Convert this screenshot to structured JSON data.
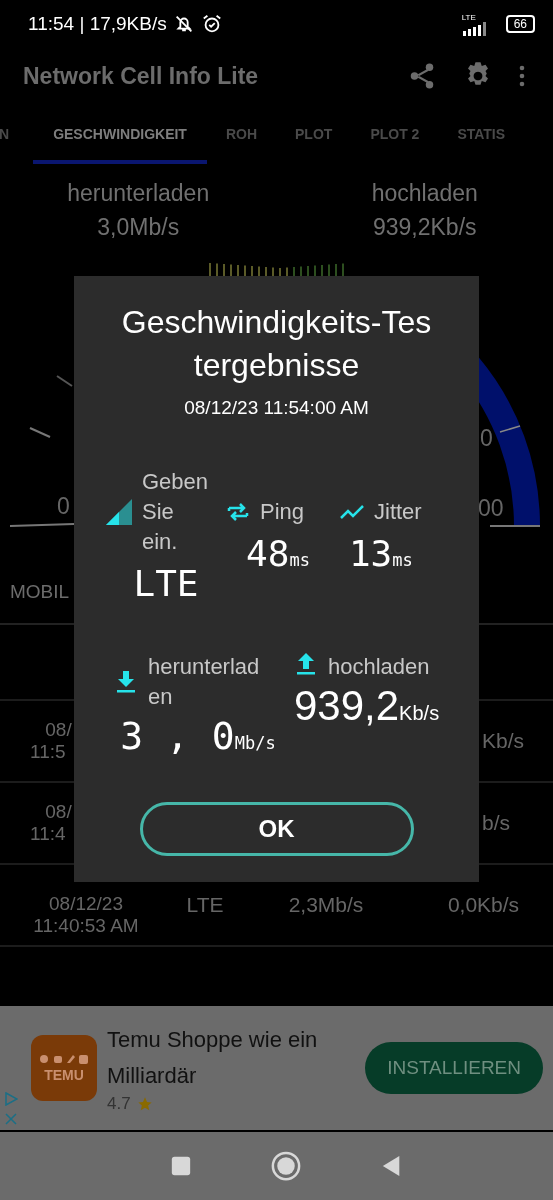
{
  "status_bar": {
    "time": "11:54 | 17,9KB/s",
    "network": "LTE",
    "battery": "66"
  },
  "app_bar": {
    "title": "Network Cell Info Lite"
  },
  "tabs": [
    {
      "label": "N",
      "selected": false
    },
    {
      "label": "GESCHWINDIGKEIT",
      "selected": true
    },
    {
      "label": "ROH",
      "selected": false
    },
    {
      "label": "PLOT",
      "selected": false
    },
    {
      "label": "PLOT 2",
      "selected": false
    },
    {
      "label": "STATIS",
      "selected": false
    }
  ],
  "summary": [
    {
      "label": "herunterladen",
      "value": "3,0Mb/s"
    },
    {
      "label": "hochladen",
      "value": "939,2Kb/s"
    }
  ],
  "gauge": {
    "scale_labels": [
      "0",
      "0",
      "00"
    ]
  },
  "section_label": "MOBIL",
  "table": {
    "rows": [
      {
        "date": "08/",
        "time": "11:5",
        "upload": "Kb/s"
      },
      {
        "date": "08/",
        "time": "11:4",
        "upload": "b/s"
      },
      {
        "date": "08/12/23",
        "time": "11:40:53 AM",
        "network": "LTE",
        "download": "2,3Mb/s",
        "upload": "0,0Kb/s"
      }
    ]
  },
  "dialog": {
    "title_lines": [
      "Geschwindigkeits-Tes",
      "tergebnisse"
    ],
    "timestamp": "08/12/23 11:54:00 AM",
    "stats": [
      {
        "kind": "network",
        "label_lines": [
          "Geben",
          "Sie",
          "ein."
        ],
        "value": "LTE"
      },
      {
        "kind": "ping",
        "label_lines": [
          "Ping"
        ],
        "value": "48",
        "unit": "ms"
      },
      {
        "kind": "jitter",
        "label_lines": [
          "Jitter"
        ],
        "value": "13",
        "unit": "ms"
      }
    ],
    "transfer": [
      {
        "kind": "download",
        "label_lines": [
          "herunterlad",
          "en"
        ],
        "value": "3 , 0",
        "unit": "Mb/s"
      },
      {
        "kind": "upload",
        "label_lines": [
          "hochladen"
        ],
        "value": "939,2",
        "unit": "Kb/s"
      }
    ],
    "button": "OK"
  },
  "ad": {
    "logo": "TEMU",
    "title": "Temu Shoppe wie ein Milliardär",
    "rating": "4.7",
    "button": "INSTALLIEREN"
  }
}
